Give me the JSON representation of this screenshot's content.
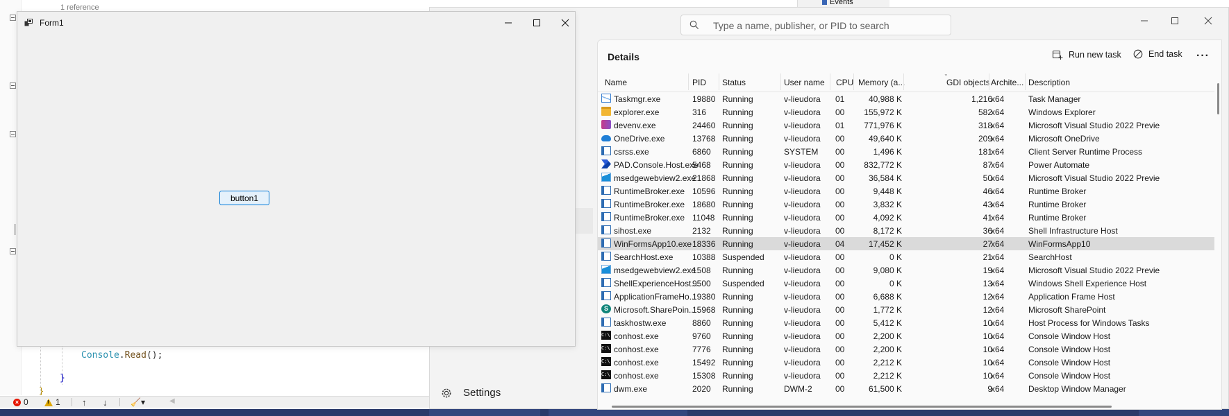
{
  "vs": {
    "ref_hint": "1 reference",
    "code": {
      "cls": "Console",
      "dot": ".",
      "method": "Read",
      "rest": "();",
      "close_brace": "}",
      "bracket_glyph": "}"
    },
    "status": {
      "errors": "0",
      "warnings": "1"
    }
  },
  "properties_panel": {
    "label": "Events"
  },
  "form1": {
    "title": "Form1",
    "button_label": "button1"
  },
  "taskmgr": {
    "search_placeholder": "Type a name, publisher, or PID to search",
    "settings_label": "Settings",
    "details_title": "Details",
    "run_new_task": "Run new task",
    "end_task": "End task",
    "more": "···",
    "columns": [
      "Name",
      "PID",
      "Status",
      "User name",
      "CPU",
      "Memory (a...",
      "GDI objects",
      "Archite...",
      "Description"
    ],
    "rows": [
      {
        "name": "Taskmgr.exe",
        "pid": "19880",
        "status": "Running",
        "user": "v-lieudora",
        "cpu": "01",
        "mem": "40,988 K",
        "gdi": "1,216",
        "arch": "x64",
        "desc": "Task Manager",
        "icon": "taskmgr-icon",
        "color": "#3b7fd0"
      },
      {
        "name": "explorer.exe",
        "pid": "316",
        "status": "Running",
        "user": "v-lieudora",
        "cpu": "00",
        "mem": "155,972 K",
        "gdi": "582",
        "arch": "x64",
        "desc": "Windows Explorer",
        "icon": "folder-icon",
        "color": "#f2b632"
      },
      {
        "name": "devenv.exe",
        "pid": "24460",
        "status": "Running",
        "user": "v-lieudora",
        "cpu": "01",
        "mem": "771,976 K",
        "gdi": "318",
        "arch": "x64",
        "desc": "Microsoft Visual Studio 2022 Previe",
        "icon": "visual-studio-icon",
        "color": "#8a4fc7"
      },
      {
        "name": "OneDrive.exe",
        "pid": "13768",
        "status": "Running",
        "user": "v-lieudora",
        "cpu": "00",
        "mem": "49,640 K",
        "gdi": "209",
        "arch": "x64",
        "desc": "Microsoft OneDrive",
        "icon": "cloud-icon",
        "color": "#1f7ed6"
      },
      {
        "name": "csrss.exe",
        "pid": "6860",
        "status": "Running",
        "user": "SYSTEM",
        "cpu": "00",
        "mem": "1,496 K",
        "gdi": "181",
        "arch": "x64",
        "desc": "Client Server Runtime Process",
        "icon": "window-icon",
        "color": "#2f6db3"
      },
      {
        "name": "PAD.Console.Host.exe",
        "pid": "5468",
        "status": "Running",
        "user": "v-lieudora",
        "cpu": "00",
        "mem": "832,772 K",
        "gdi": "87",
        "arch": "x64",
        "desc": "Power Automate",
        "icon": "power-automate-icon",
        "color": "#2a5bd7"
      },
      {
        "name": "msedgewebview2.exe",
        "pid": "21868",
        "status": "Running",
        "user": "v-lieudora",
        "cpu": "00",
        "mem": "36,584 K",
        "gdi": "50",
        "arch": "x64",
        "desc": "Microsoft Visual Studio 2022 Previe",
        "icon": "webview-icon",
        "color": "#1a8fd9"
      },
      {
        "name": "RuntimeBroker.exe",
        "pid": "10596",
        "status": "Running",
        "user": "v-lieudora",
        "cpu": "00",
        "mem": "9,448 K",
        "gdi": "46",
        "arch": "x64",
        "desc": "Runtime Broker",
        "icon": "window-icon",
        "color": "#2f6db3"
      },
      {
        "name": "RuntimeBroker.exe",
        "pid": "18680",
        "status": "Running",
        "user": "v-lieudora",
        "cpu": "00",
        "mem": "3,832 K",
        "gdi": "43",
        "arch": "x64",
        "desc": "Runtime Broker",
        "icon": "window-icon",
        "color": "#2f6db3"
      },
      {
        "name": "RuntimeBroker.exe",
        "pid": "11048",
        "status": "Running",
        "user": "v-lieudora",
        "cpu": "00",
        "mem": "4,092 K",
        "gdi": "41",
        "arch": "x64",
        "desc": "Runtime Broker",
        "icon": "window-icon",
        "color": "#2f6db3"
      },
      {
        "name": "sihost.exe",
        "pid": "2132",
        "status": "Running",
        "user": "v-lieudora",
        "cpu": "00",
        "mem": "8,172 K",
        "gdi": "36",
        "arch": "x64",
        "desc": "Shell Infrastructure Host",
        "icon": "window-icon",
        "color": "#2f6db3"
      },
      {
        "name": "WinFormsApp10.exe",
        "pid": "18336",
        "status": "Running",
        "user": "v-lieudora",
        "cpu": "04",
        "mem": "17,452 K",
        "gdi": "27",
        "arch": "x64",
        "desc": "WinFormsApp10",
        "icon": "window-icon",
        "color": "#2f6db3",
        "selected": true
      },
      {
        "name": "SearchHost.exe",
        "pid": "10388",
        "status": "Suspended",
        "user": "v-lieudora",
        "cpu": "00",
        "mem": "0 K",
        "gdi": "21",
        "arch": "x64",
        "desc": "SearchHost",
        "icon": "window-icon",
        "color": "#2f6db3"
      },
      {
        "name": "msedgewebview2.exe",
        "pid": "1508",
        "status": "Running",
        "user": "v-lieudora",
        "cpu": "00",
        "mem": "9,080 K",
        "gdi": "19",
        "arch": "x64",
        "desc": "Microsoft Visual Studio 2022 Previe",
        "icon": "webview-icon",
        "color": "#1a8fd9"
      },
      {
        "name": "ShellExperienceHost....",
        "pid": "9500",
        "status": "Suspended",
        "user": "v-lieudora",
        "cpu": "00",
        "mem": "0 K",
        "gdi": "13",
        "arch": "x64",
        "desc": "Windows Shell Experience Host",
        "icon": "window-icon",
        "color": "#2f6db3"
      },
      {
        "name": "ApplicationFrameHo...",
        "pid": "19380",
        "status": "Running",
        "user": "v-lieudora",
        "cpu": "00",
        "mem": "6,688 K",
        "gdi": "12",
        "arch": "x64",
        "desc": "Application Frame Host",
        "icon": "window-icon",
        "color": "#2f6db3"
      },
      {
        "name": "Microsoft.SharePoin...",
        "pid": "15968",
        "status": "Running",
        "user": "v-lieudora",
        "cpu": "00",
        "mem": "1,772 K",
        "gdi": "12",
        "arch": "x64",
        "desc": "Microsoft SharePoint",
        "icon": "sharepoint-icon",
        "color": "#11857a"
      },
      {
        "name": "taskhostw.exe",
        "pid": "8860",
        "status": "Running",
        "user": "v-lieudora",
        "cpu": "00",
        "mem": "5,412 K",
        "gdi": "10",
        "arch": "x64",
        "desc": "Host Process for Windows Tasks",
        "icon": "window-icon",
        "color": "#2f6db3"
      },
      {
        "name": "conhost.exe",
        "pid": "9760",
        "status": "Running",
        "user": "v-lieudora",
        "cpu": "00",
        "mem": "2,200 K",
        "gdi": "10",
        "arch": "x64",
        "desc": "Console Window Host",
        "icon": "console-icon",
        "color": "#111111"
      },
      {
        "name": "conhost.exe",
        "pid": "7776",
        "status": "Running",
        "user": "v-lieudora",
        "cpu": "00",
        "mem": "2,200 K",
        "gdi": "10",
        "arch": "x64",
        "desc": "Console Window Host",
        "icon": "console-icon",
        "color": "#111111"
      },
      {
        "name": "conhost.exe",
        "pid": "15492",
        "status": "Running",
        "user": "v-lieudora",
        "cpu": "00",
        "mem": "2,212 K",
        "gdi": "10",
        "arch": "x64",
        "desc": "Console Window Host",
        "icon": "console-icon",
        "color": "#111111"
      },
      {
        "name": "conhost.exe",
        "pid": "15308",
        "status": "Running",
        "user": "v-lieudora",
        "cpu": "00",
        "mem": "2,212 K",
        "gdi": "10",
        "arch": "x64",
        "desc": "Console Window Host",
        "icon": "console-icon",
        "color": "#111111"
      },
      {
        "name": "dwm.exe",
        "pid": "2020",
        "status": "Running",
        "user": "DWM-2",
        "cpu": "00",
        "mem": "61,500 K",
        "gdi": "9",
        "arch": "x64",
        "desc": "Desktop Window Manager",
        "icon": "window-icon",
        "color": "#2f6db3"
      }
    ]
  }
}
